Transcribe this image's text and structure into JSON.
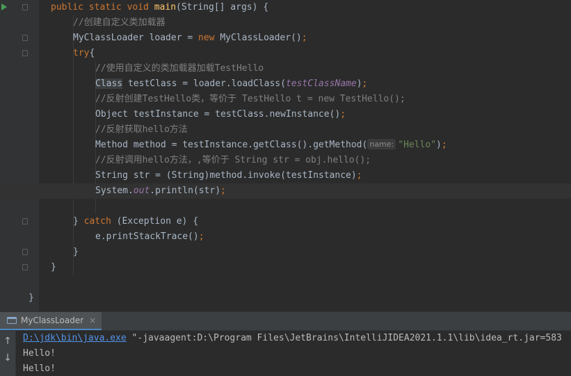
{
  "editor": {
    "line1": {
      "kw1": "public static void ",
      "fn": "main",
      "rest": "(String[] args) {"
    },
    "line2": {
      "comment": "//创建自定义类加载器"
    },
    "line3": {
      "a": "MyClassLoader loader = ",
      "kw": "new",
      "b": " MyClassLoader()",
      "semi": ";"
    },
    "line4": {
      "kw": "try",
      "b": "{"
    },
    "line5": {
      "comment": "//使用自定义的类加载器加载TestHello"
    },
    "line6": {
      "cls": "Class",
      "a": " testClass = loader.loadClass(",
      "param": "testClassName",
      "b": ")",
      "semi": ";"
    },
    "line7": {
      "comment": "//反射创建TestHello类，等价于 TestHello t = new TestHello();"
    },
    "line8": {
      "a": "Object testInstance = testClass.newInstance()",
      "semi": ";"
    },
    "line9": {
      "comment": "//反射获取hello方法"
    },
    "line10": {
      "a": "Method method = testInstance.getClass().getMethod(",
      "hint": "name:",
      "str": "\"Hello\"",
      "b": ")",
      "semi": ";"
    },
    "line11": {
      "comment": "//反射调用hello方法，,等价于 String str = obj.hello();"
    },
    "line12": {
      "a": "String str = (String)method.invoke(testInstance)",
      "semi": ";"
    },
    "line13": {
      "a": "System.",
      "stat": "out",
      "b": ".println(str)",
      "semi": ";"
    },
    "line15": {
      "a": "} ",
      "kw": "catch",
      "b": " (Exception e) {"
    },
    "line16": {
      "a": "e.printStackTrace()",
      "semi": ";"
    },
    "line17": {
      "a": "}"
    },
    "line18": {
      "a": "}"
    },
    "line20": {
      "a": "}"
    }
  },
  "run": {
    "tab_label": "MyClassLoader",
    "tab_close": "×",
    "up_arrow": "↑",
    "down_arrow": "↓",
    "console": {
      "cmd_link": "D:\\jdk\\bin\\java.exe",
      "cmd_rest": " \"-javaagent:D:\\Program Files\\JetBrains\\IntelliJIDEA2021.1.1\\lib\\idea_rt.jar=583",
      "out1": "Hello!",
      "out2": "Hello!"
    }
  },
  "colors": {
    "background": "#2b2b2b",
    "keyword": "#cc7832",
    "method_decl": "#ffc66d",
    "comment": "#808080",
    "string": "#6a8759",
    "param": "#9876aa",
    "link": "#5394ec"
  },
  "icons": [
    "run-gutter-icon",
    "fold-icon",
    "console-tab-icon",
    "close-icon",
    "up-arrow-icon",
    "down-arrow-icon"
  ]
}
